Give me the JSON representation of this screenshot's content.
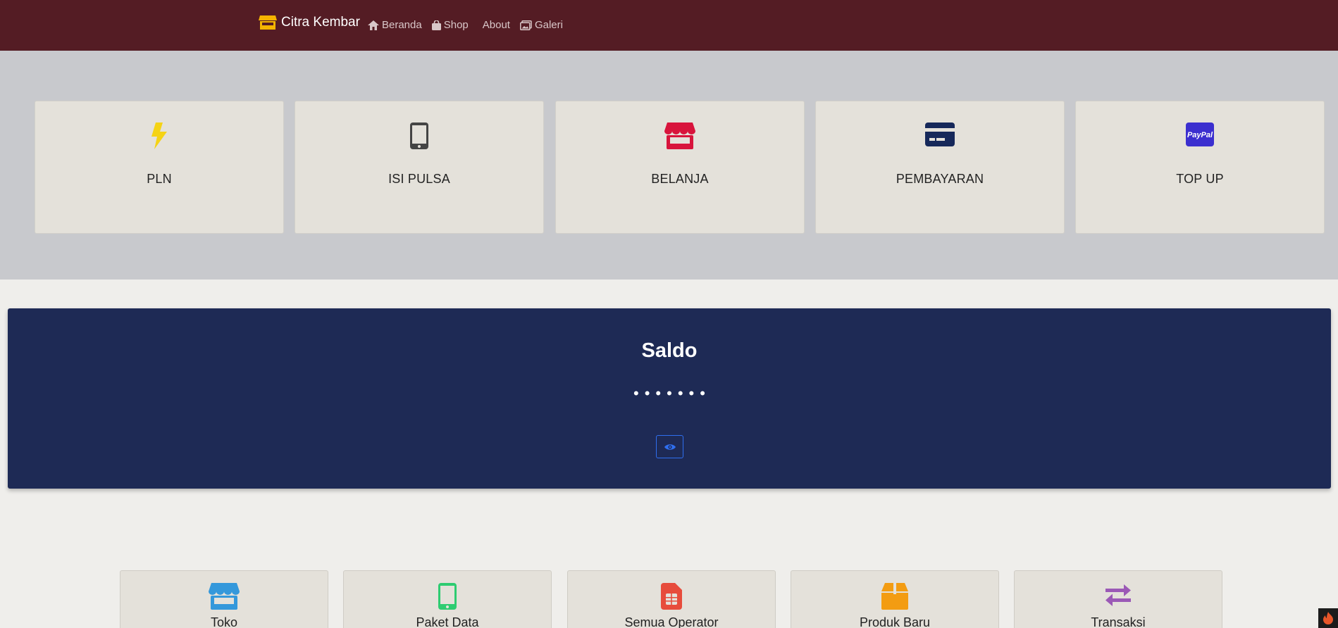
{
  "navbar": {
    "brand": "Citra Kembar",
    "brand_icon": "store-icon",
    "links": [
      {
        "label": "Beranda",
        "icon": "home-icon"
      },
      {
        "label": "Shop",
        "icon": "shopping-bag-icon"
      },
      {
        "label": "About",
        "icon": ""
      },
      {
        "label": "Galeri",
        "icon": "images-icon"
      }
    ]
  },
  "services": [
    {
      "label": "PLN",
      "icon": "bolt-icon",
      "color": "#f5d315"
    },
    {
      "label": "ISI PULSA",
      "icon": "mobile-icon",
      "color": "#444444"
    },
    {
      "label": "BELANJA",
      "icon": "store-icon",
      "color": "#d8143c"
    },
    {
      "label": "PEMBAYARAN",
      "icon": "credit-card-icon",
      "color": "#16285a"
    },
    {
      "label": "TOP UP",
      "icon": "paypal-icon",
      "color": "#3b2fcf",
      "icon_text": "PayPal"
    }
  ],
  "saldo": {
    "title": "Saldo",
    "hidden_value": "•••••••",
    "toggle_icon": "eye-icon"
  },
  "tiles": [
    {
      "label": "Toko",
      "icon": "store-icon",
      "color": "#3498db"
    },
    {
      "label": "Paket Data",
      "icon": "mobile-icon",
      "color": "#2ecc71"
    },
    {
      "label": "Semua Operator",
      "icon": "sim-card-icon",
      "color": "#e74c3c"
    },
    {
      "label": "Produk Baru",
      "icon": "box-icon",
      "color": "#f39c12"
    },
    {
      "label": "Transaksi",
      "icon": "exchange-icon",
      "color": "#9b59b6"
    }
  ]
}
